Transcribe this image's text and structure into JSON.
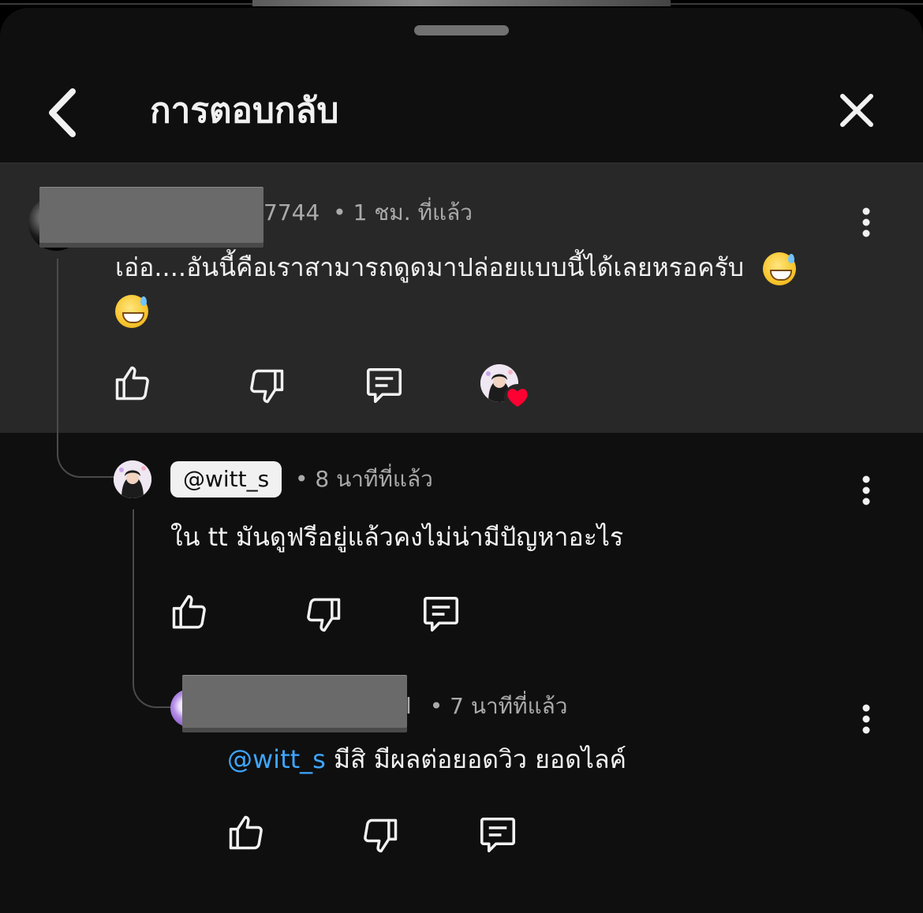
{
  "header": {
    "title": "การตอบกลับ"
  },
  "parent_comment": {
    "handle_suffix": "7744",
    "time": "• 1 ชม. ที่แล้ว",
    "text": "เอ่อ....อันนี้คือเราสามารถดูดมาปล่อยแบบนี้ได้เลยหรอครับ",
    "emoji": "grinning-face-with-sweat",
    "creator_heart": true
  },
  "reply_1": {
    "handle": "@witt_s",
    "time": "• 8 นาทีที่แล้ว",
    "text": "ใน tt มันดูฟรีอยู่แล้วคงไม่น่ามีปัญหาอะไร"
  },
  "reply_2": {
    "handle_suffix": "l",
    "time": "• 7 นาทีที่แล้ว",
    "mention": "@witt_s",
    "text": " มีสิ มีผลต่อยอดวิว ยอดไลค์"
  },
  "colors": {
    "sheet_bg": "#0f0f0f",
    "highlight_bg": "#282828",
    "text_primary": "#f1f1f1",
    "text_secondary": "#aaaaaa",
    "mention": "#3ea6ff",
    "heart": "#ff0033"
  }
}
